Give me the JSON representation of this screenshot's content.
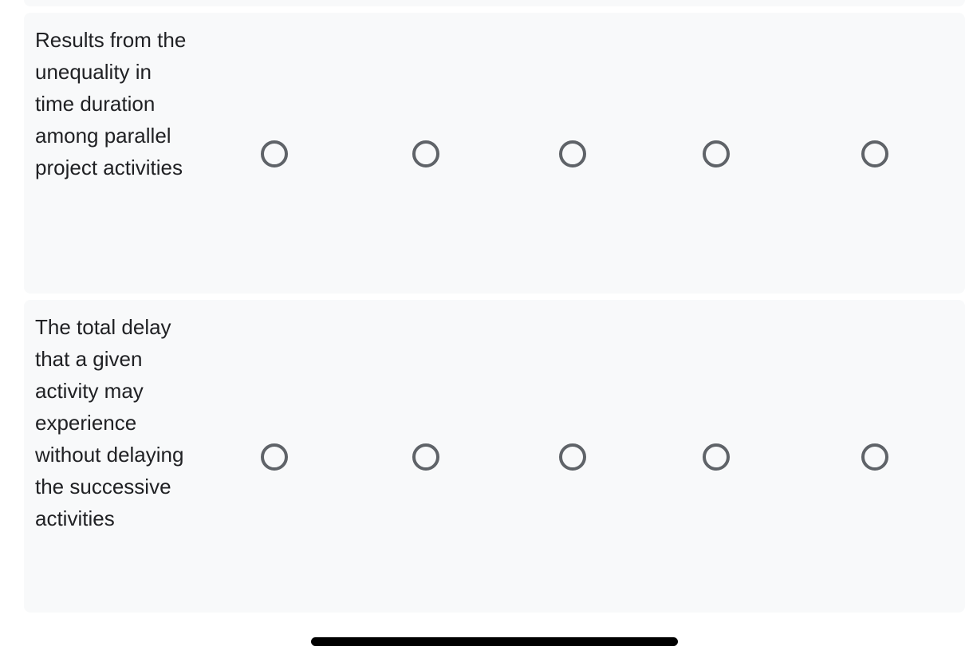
{
  "grid": {
    "rows": [
      {
        "label": "Results from the unequality in time duration among parallel project activities",
        "options_count": 5,
        "selected": null
      },
      {
        "label": "The total delay that a given activity may experience without delaying the successive activities",
        "options_count": 5,
        "selected": null
      }
    ]
  },
  "colors": {
    "row_background": "#f8f9fa",
    "radio_border": "#5f6368",
    "text": "#202124"
  }
}
